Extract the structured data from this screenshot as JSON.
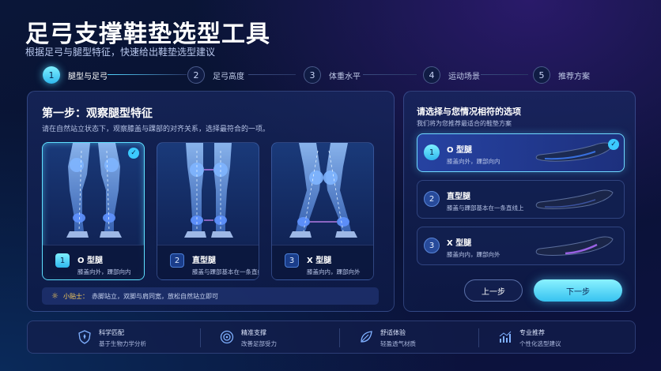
{
  "header": {
    "title": "足弓支撑鞋垫选型工具",
    "subtitle": "根据足弓与腿型特征，快速给出鞋垫选型建议"
  },
  "steps": [
    {
      "num": "1",
      "label": "腿型与足弓",
      "active": true
    },
    {
      "num": "2",
      "label": "足弓高度",
      "active": false
    },
    {
      "num": "3",
      "label": "体重水平",
      "active": false
    },
    {
      "num": "4",
      "label": "运动场景",
      "active": false
    },
    {
      "num": "5",
      "label": "推荐方案",
      "active": false
    }
  ],
  "left_panel": {
    "title": "第一步：观察腿型特征",
    "desc": "请在自然站立状态下，观察膝盖与踝部的对齐关系，选择最符合的一项。",
    "cards": [
      {
        "num": "1",
        "name": "O 型腿",
        "sub": "膝盖向外，踝部向内",
        "selected": true
      },
      {
        "num": "2",
        "name": "直型腿",
        "sub": "膝盖与踝部基本在一条直线上",
        "selected": false
      },
      {
        "num": "3",
        "name": "X 型腿",
        "sub": "膝盖向内，踝部向外",
        "selected": false
      }
    ],
    "tip_label": "小贴士：",
    "tip_text": "赤脚站立，双脚与肩同宽，放松自然站立即可"
  },
  "right_panel": {
    "title": "请选择与您情况相符的选项",
    "desc": "我们将为您推荐最适合的鞋垫方案",
    "options": [
      {
        "num": "1",
        "name": "O 型腿",
        "sub": "膝盖向外，踝部向内",
        "selected": true
      },
      {
        "num": "2",
        "name": "直型腿",
        "sub": "膝盖与踝部基本在一条直线上",
        "selected": false
      },
      {
        "num": "3",
        "name": "X 型腿",
        "sub": "膝盖向内，踝部向外",
        "selected": false
      }
    ],
    "prev_label": "上一步",
    "next_label": "下一步"
  },
  "features": [
    {
      "icon": "shield-icon",
      "title": "科学匹配",
      "sub": "基于生物力学分析"
    },
    {
      "icon": "target-icon",
      "title": "精准支撑",
      "sub": "改善足部受力"
    },
    {
      "icon": "leaf-icon",
      "title": "舒适体验",
      "sub": "轻盈透气材质"
    },
    {
      "icon": "chart-icon",
      "title": "专业推荐",
      "sub": "个性化选型建议"
    }
  ],
  "colors": {
    "accent": "#3ccaff",
    "background": "#0a1638"
  }
}
